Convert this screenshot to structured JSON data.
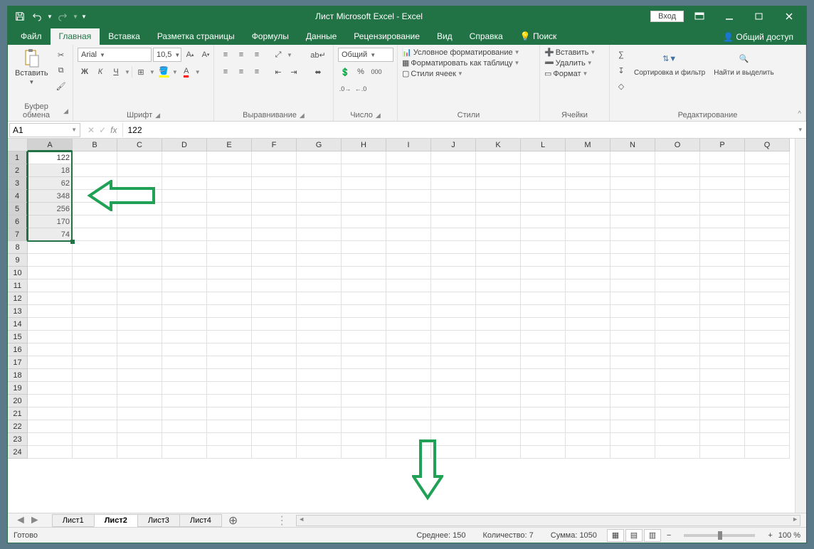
{
  "title": "Лист Microsoft Excel  -  Excel",
  "login": "Вход",
  "tabs": {
    "file": "Файл",
    "home": "Главная",
    "insert": "Вставка",
    "layout": "Разметка страницы",
    "formulas": "Формулы",
    "data": "Данные",
    "review": "Рецензирование",
    "view": "Вид",
    "help": "Справка",
    "search": "Поиск",
    "share": "Общий доступ"
  },
  "ribbon": {
    "clipboard": {
      "paste": "Вставить",
      "label": "Буфер обмена"
    },
    "font": {
      "name": "Arial",
      "size": "10,5",
      "label": "Шрифт",
      "bold": "Ж",
      "italic": "К",
      "underline": "Ч"
    },
    "alignment": {
      "label": "Выравнивание"
    },
    "number": {
      "format": "Общий",
      "label": "Число"
    },
    "styles": {
      "cond": "Условное форматирование",
      "table": "Форматировать как таблицу",
      "cell": "Стили ячеек",
      "label": "Стили"
    },
    "cells": {
      "insert": "Вставить",
      "delete": "Удалить",
      "format": "Формат",
      "label": "Ячейки"
    },
    "editing": {
      "sort": "Сортировка и фильтр",
      "find": "Найти и выделить",
      "label": "Редактирование"
    }
  },
  "namebox": "A1",
  "formula": "122",
  "columns": [
    "A",
    "B",
    "C",
    "D",
    "E",
    "F",
    "G",
    "H",
    "I",
    "J",
    "K",
    "L",
    "M",
    "N",
    "O",
    "P",
    "Q"
  ],
  "rows": 24,
  "cellData": {
    "A1": "122",
    "A2": "18",
    "A3": "62",
    "A4": "348",
    "A5": "256",
    "A6": "170",
    "A7": "74"
  },
  "sheets": {
    "s1": "Лист1",
    "s2": "Лист2",
    "s3": "Лист3",
    "s4": "Лист4"
  },
  "status": {
    "ready": "Готово",
    "avg": "Среднее: 150",
    "count": "Количество: 7",
    "sum": "Сумма: 1050",
    "zoom": "100 %"
  }
}
